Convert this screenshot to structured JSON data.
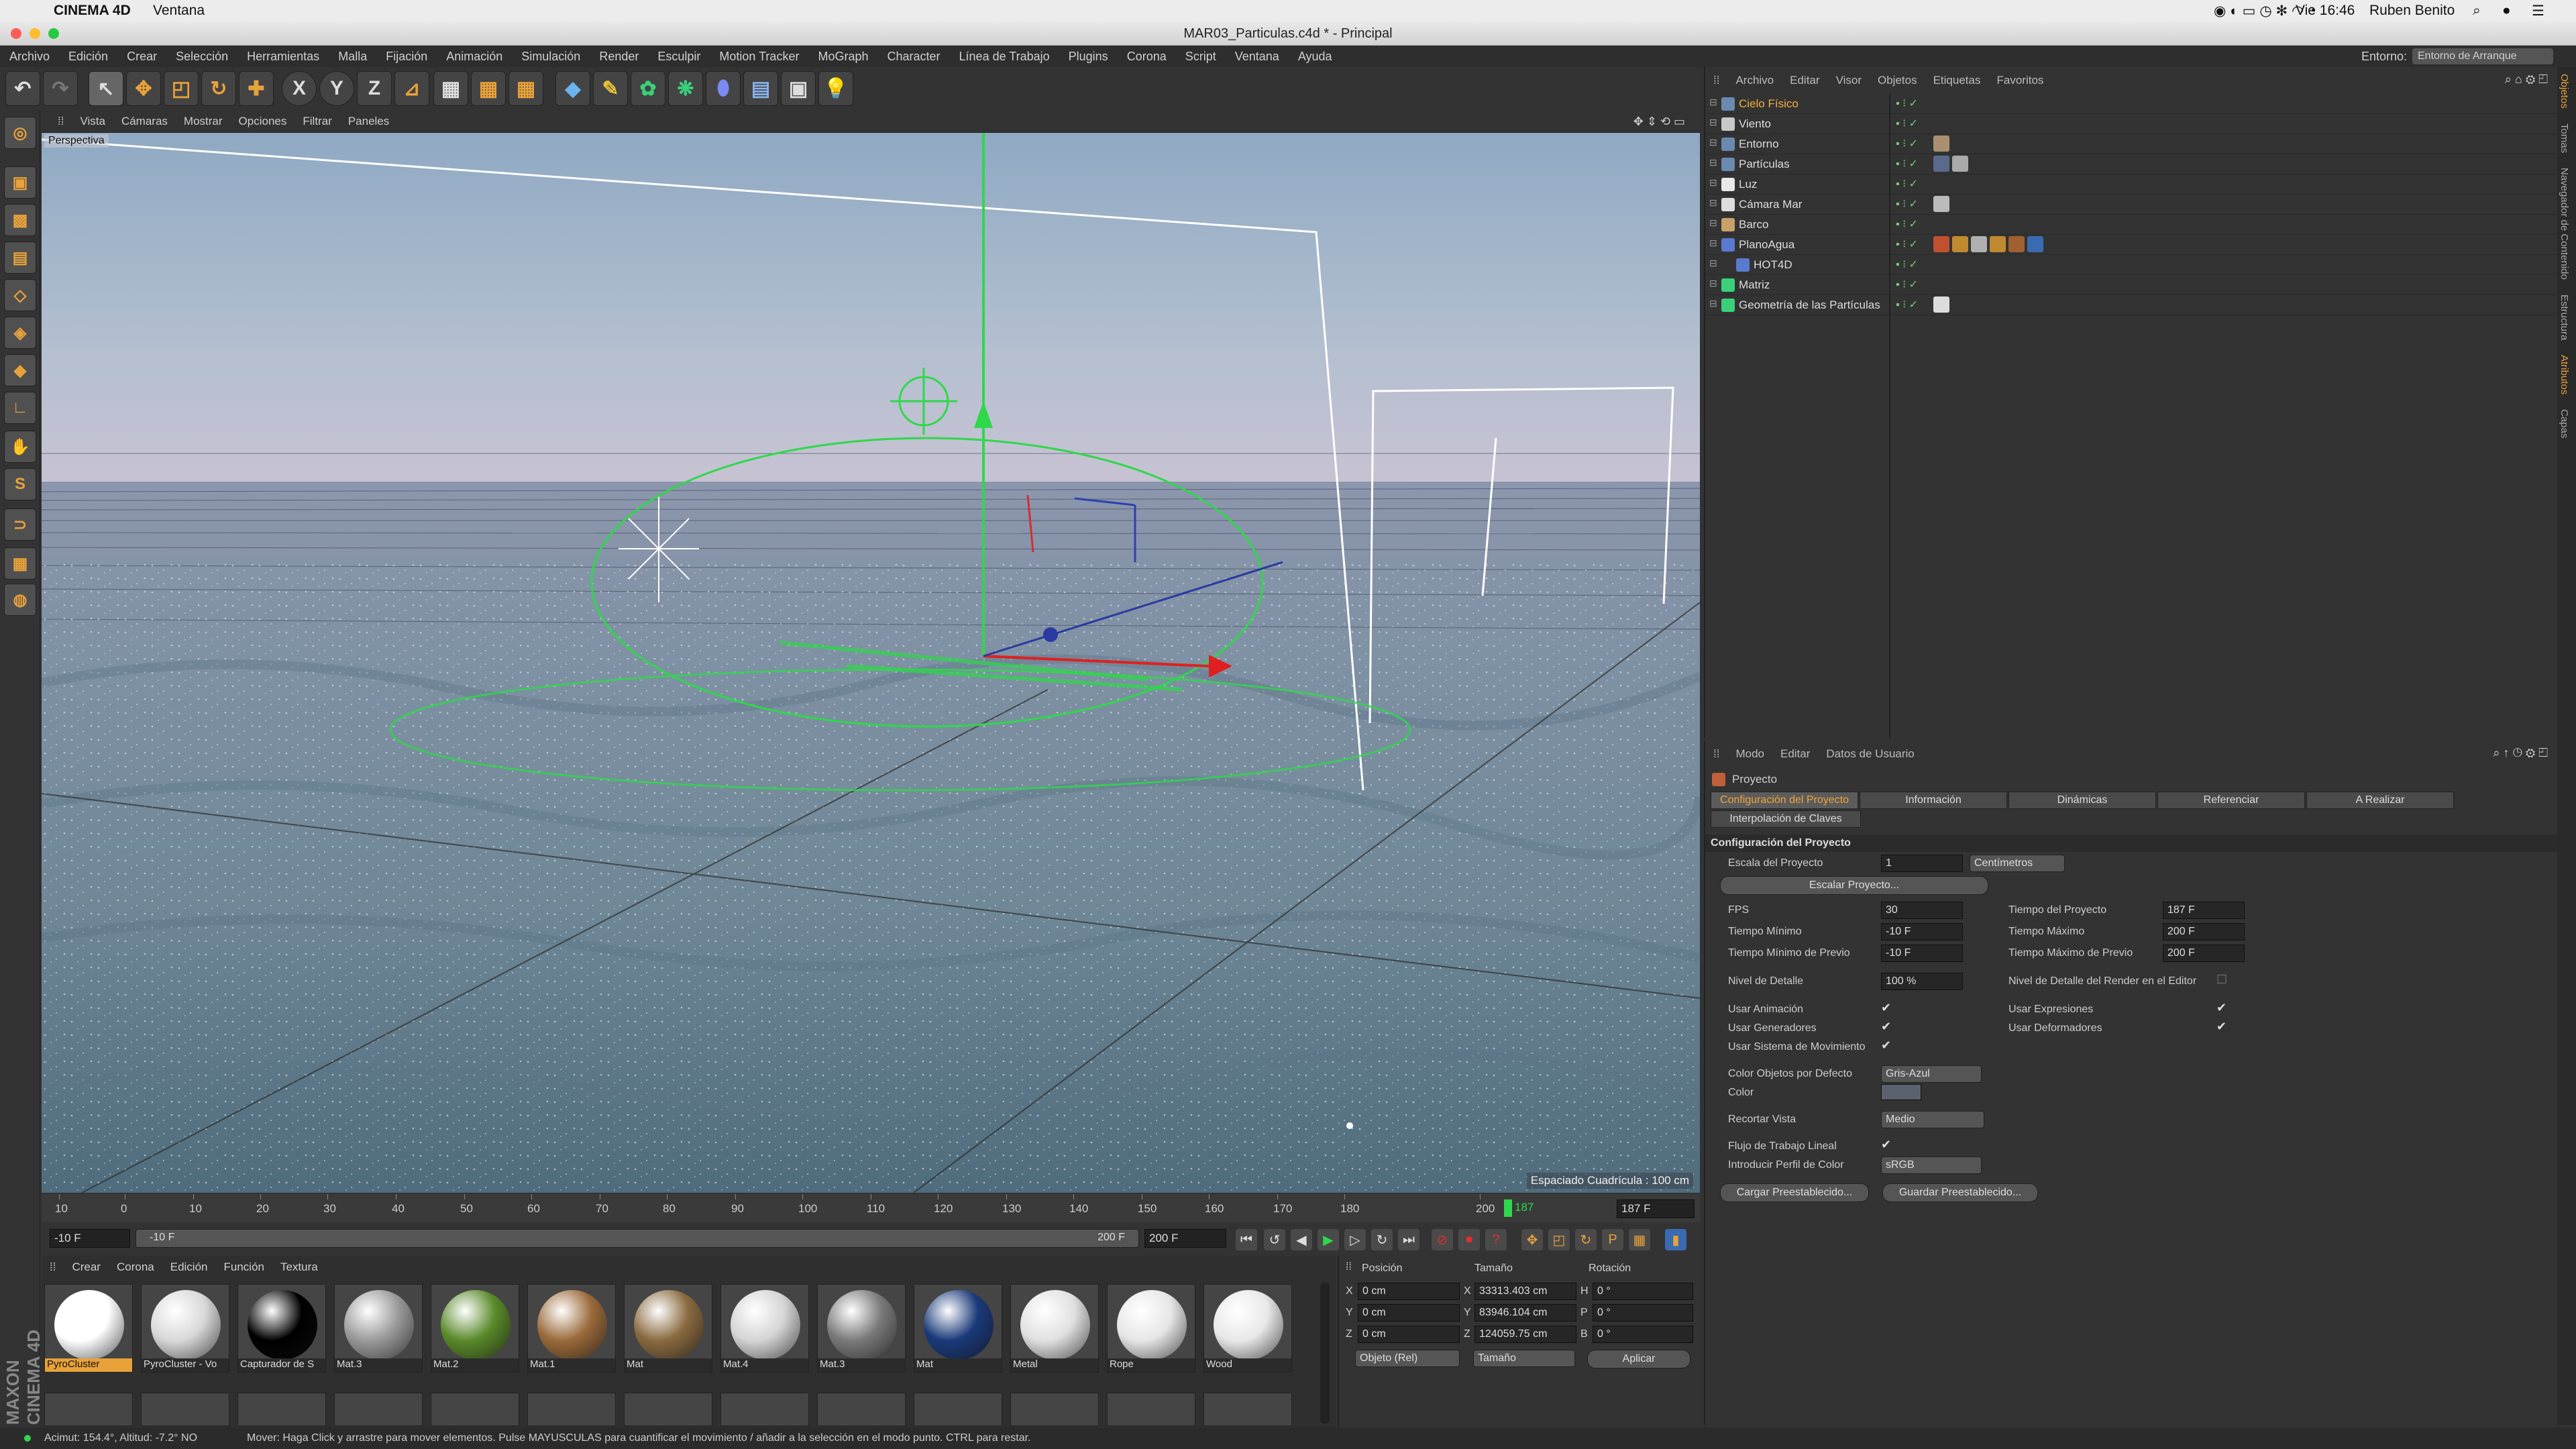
{
  "mac": {
    "app": "CINEMA 4D",
    "menu": "Ventana",
    "clock": "Vie 16:46",
    "user": "Ruben Benito"
  },
  "window": {
    "title": "MAR03_Particulas.c4d * - Principal"
  },
  "menu": [
    "Archivo",
    "Edición",
    "Crear",
    "Selección",
    "Herramientas",
    "Malla",
    "Fijación",
    "Animación",
    "Simulación",
    "Render",
    "Esculpir",
    "Motion Tracker",
    "MoGraph",
    "Character",
    "Línea de Trabajo",
    "Plugins",
    "Corona",
    "Script",
    "Ventana",
    "Ayuda"
  ],
  "layout": {
    "label": "Entorno:",
    "value": "Entorno de Arranque"
  },
  "viewport": {
    "menu": [
      "Vista",
      "Cámaras",
      "Mostrar",
      "Opciones",
      "Filtrar",
      "Paneles"
    ],
    "label": "Perspectiva",
    "grid": "Espaciado Cuadrícula : 100 cm"
  },
  "timeline": {
    "ticks": [
      "10",
      "0",
      "10",
      "20",
      "30",
      "40",
      "50",
      "60",
      "70",
      "80",
      "90",
      "100",
      "110",
      "120",
      "130",
      "140",
      "150",
      "160",
      "170",
      "180",
      "200"
    ],
    "current": "187",
    "current_field": "187 F",
    "start": "-10 F",
    "range_start": "-10 F",
    "range_end": "200 F",
    "end": "200 F"
  },
  "materials": {
    "menu": [
      "Crear",
      "Corona",
      "Edición",
      "Función",
      "Textura"
    ],
    "items": [
      {
        "name": "PyroCluster",
        "color": "#ffffff"
      },
      {
        "name": "PyroCluster - Vo",
        "color": "#d8d8d8"
      },
      {
        "name": "Capturador de S",
        "color": "#000000"
      },
      {
        "name": "Mat.3",
        "color": "#9a9a9a"
      },
      {
        "name": "Mat.2",
        "color": "#5a8a2a"
      },
      {
        "name": "Mat.1",
        "color": "#9a6a3a"
      },
      {
        "name": "Mat",
        "color": "#8a6a40"
      },
      {
        "name": "Mat.4",
        "color": "#d4d4d4"
      },
      {
        "name": "Mat.3",
        "color": "#7a7a7a"
      },
      {
        "name": "Mat",
        "color": "#1a3a7a"
      },
      {
        "name": "Metal",
        "color": "#e0e0e0"
      },
      {
        "name": "Rope",
        "color": "#e6e6e6"
      },
      {
        "name": "Wood",
        "color": "#e8e8e8"
      }
    ]
  },
  "coords": {
    "headers": [
      "Posición",
      "Tamaño",
      "Rotación"
    ],
    "rows": [
      {
        "axis": "X",
        "pos": "0 cm",
        "size_axis": "X",
        "size": "33313.403 cm",
        "rot_axis": "H",
        "rot": "0 °"
      },
      {
        "axis": "Y",
        "pos": "0 cm",
        "size_axis": "Y",
        "size": "83946.104 cm",
        "rot_axis": "P",
        "rot": "0 °"
      },
      {
        "axis": "Z",
        "pos": "0 cm",
        "size_axis": "Z",
        "size": "124059.75 cm",
        "rot_axis": "B",
        "rot": "0 °"
      }
    ],
    "mode": "Objeto (Rel)",
    "size_mode": "Tamaño",
    "apply": "Aplicar"
  },
  "objects": {
    "menu": [
      "Archivo",
      "Editar",
      "Visor",
      "Objetos",
      "Etiquetas",
      "Favoritos"
    ],
    "items": [
      {
        "name": "Cielo Físico",
        "hl": true
      },
      {
        "name": "Viento"
      },
      {
        "name": "Entorno"
      },
      {
        "name": "Partículas"
      },
      {
        "name": "Luz"
      },
      {
        "name": "Cámara Mar"
      },
      {
        "name": "Barco"
      },
      {
        "name": "PlanoAgua"
      },
      {
        "name": "HOT4D",
        "indent": true
      },
      {
        "name": "Matriz"
      },
      {
        "name": "Geometría de las Partículas"
      }
    ]
  },
  "attributes": {
    "menu": [
      "Modo",
      "Editar",
      "Datos de Usuario"
    ],
    "object": "Proyecto",
    "tabs": [
      "Configuración del Proyecto",
      "Información",
      "Dinámicas",
      "Referenciar",
      "A Realizar"
    ],
    "tab2": "Interpolación de Claves",
    "section": "Configuración del Proyecto",
    "scale_label": "Escala del Proyecto",
    "scale_value": "1",
    "scale_unit": "Centímetros",
    "scale_btn": "Escalar Proyecto...",
    "fps_label": "FPS",
    "fps": "30",
    "tproj_label": "Tiempo del Proyecto",
    "tproj": "187 F",
    "tmin_label": "Tiempo Mínimo",
    "tmin": "-10 F",
    "tmax_label": "Tiempo Máximo",
    "tmax": "200 F",
    "tprevmin_label": "Tiempo Mínimo de Previo",
    "tprevmin": "-10 F",
    "tprevmax_label": "Tiempo Máximo de Previo",
    "tprevmax": "200 F",
    "lod_label": "Nivel de Detalle",
    "lod": "100 %",
    "lodr_label": "Nivel de Detalle del Render en el Editor",
    "anim_label": "Usar Animación",
    "expr_label": "Usar Expresiones",
    "gen_label": "Usar Generadores",
    "def_label": "Usar Deformadores",
    "motion_label": "Usar Sistema de Movimiento",
    "colobj_label": "Color Objetos por Defecto",
    "colobj": "Gris-Azul",
    "color_label": "Color",
    "clip_label": "Recortar Vista",
    "clip": "Medio",
    "linear_label": "Flujo de Trabajo Lineal",
    "profile_label": "Introducir Perfil de Color",
    "profile": "sRGB",
    "load_preset": "Cargar Preestablecido...",
    "save_preset": "Guardar Preestablecido..."
  },
  "right_tabs": [
    "Objetos",
    "Tomas",
    "Navegador de Contenido",
    "Estructura",
    "Atributos",
    "Capas"
  ],
  "status": {
    "left": "Acimut: 154.4°, Altitud: -7.2° NO",
    "msg": "Mover: Haga Click y arrastre para mover elementos. Pulse MAYUSCULAS para cuantificar el movimiento / añadir a la selección en el modo punto. CTRL para restar."
  },
  "branding": "MAXON CINEMA 4D"
}
